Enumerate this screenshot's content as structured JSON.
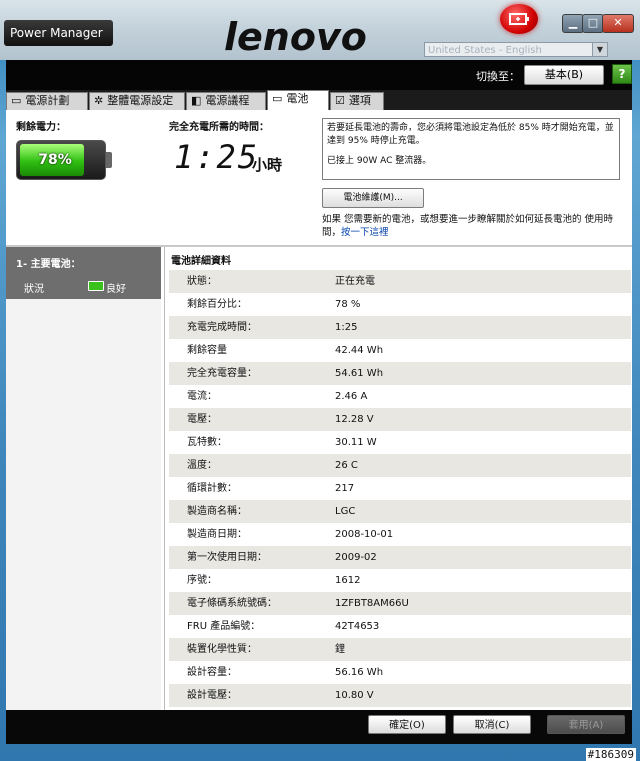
{
  "window": {
    "title": "Power Manager",
    "brand": "lenovo",
    "language": "United States - English",
    "min_glyph": "▁",
    "max_glyph": "□",
    "close_glyph": "✕"
  },
  "header": {
    "switch_label": "切換至：",
    "mode_button": "基本(B)",
    "help_glyph": "?"
  },
  "tabs": [
    {
      "label": "電源計劃",
      "icon": "battery-small-icon",
      "glyph": "▭",
      "active": false
    },
    {
      "label": "整體電源設定",
      "icon": "gear-icon",
      "glyph": "✲",
      "active": false
    },
    {
      "label": "電源議程",
      "icon": "schedule-icon",
      "glyph": "◧",
      "active": false
    },
    {
      "label": "電池",
      "icon": "battery-tab-icon",
      "glyph": "▭",
      "active": true
    },
    {
      "label": "選項",
      "icon": "checkbox-icon",
      "glyph": "☑",
      "active": false
    }
  ],
  "battery_panel": {
    "remain_label": "剩餘電力：",
    "percent": "78%",
    "level": 0.78,
    "fullcharge_label": "完全充電所需的時間：",
    "time": "1:25",
    "time_unit": "小時",
    "info_msg1": "若要延長電池的壽命，您必須將電池設定為低於 85% 時才開始充電，並達到 95% 時停止充電。",
    "info_msg2": "已接上 90W AC 整流器。",
    "maintenance_button": "電池維護(M)...",
    "maint_note": "如果 您需要新的電池，或想要進一步瞭解關於如何延長電池的 使用時間，",
    "maint_link": "按一下這裡"
  },
  "left_panel": {
    "title": "1- 主要電池：",
    "status_label": "狀況",
    "status_value": "良好"
  },
  "details": {
    "title": "電池詳細資料",
    "rows": [
      {
        "label": "狀態：",
        "value": "正在充電"
      },
      {
        "label": "剩餘百分比：",
        "value": "78 %"
      },
      {
        "label": "充電完成時間：",
        "value": "1:25"
      },
      {
        "label": "剩餘容量",
        "value": "42.44 Wh"
      },
      {
        "label": "完全充電容量：",
        "value": "54.61 Wh"
      },
      {
        "label": "電流：",
        "value": "2.46 A"
      },
      {
        "label": "電壓：",
        "value": "12.28 V"
      },
      {
        "label": "瓦特數：",
        "value": "30.11 W"
      },
      {
        "label": "溫度：",
        "value": "26 C"
      },
      {
        "label": "循環計數：",
        "value": "217"
      },
      {
        "label": "製造商名稱：",
        "value": "LGC"
      },
      {
        "label": "製造商日期：",
        "value": "2008-10-01"
      },
      {
        "label": "第一次使用日期：",
        "value": "2009-02"
      },
      {
        "label": "序號：",
        "value": "1612"
      },
      {
        "label": "電子條碼系統號碼：",
        "value": "1ZFBT8AM66U"
      },
      {
        "label": "FRU 產品編號：",
        "value": "42T4653"
      },
      {
        "label": "裝置化學性質：",
        "value": "鋰"
      },
      {
        "label": "設計容量：",
        "value": "56.16 Wh"
      },
      {
        "label": "設計電壓：",
        "value": "10.80 V"
      }
    ]
  },
  "footer": {
    "ok": "確定(O)",
    "cancel": "取消(C)",
    "apply": "套用(A)"
  },
  "watermark": "#186309"
}
